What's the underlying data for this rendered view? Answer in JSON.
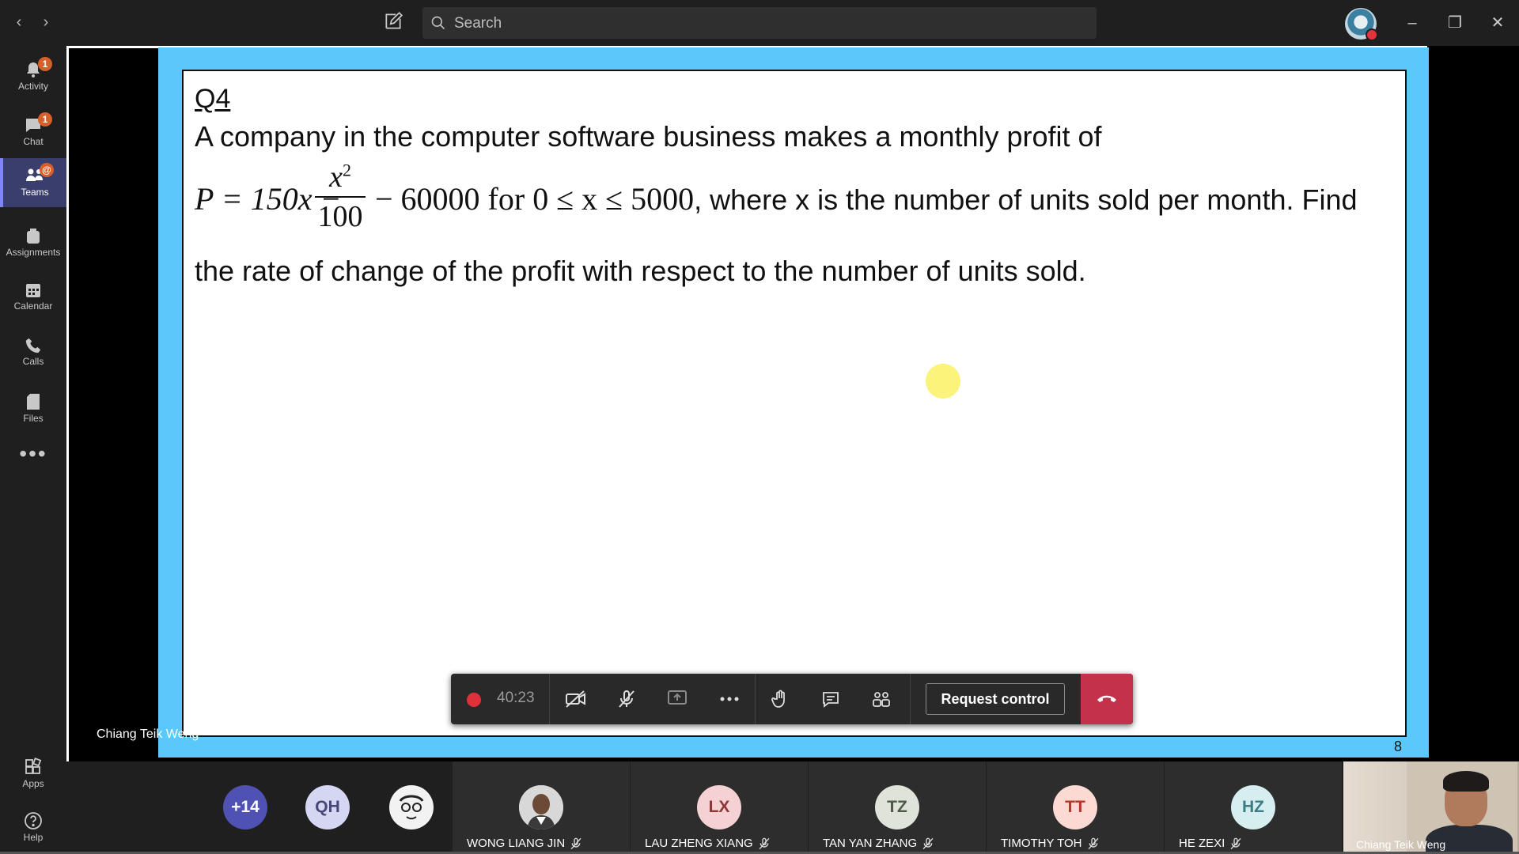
{
  "titlebar": {
    "search_placeholder": "Search"
  },
  "rail": {
    "items": [
      {
        "label": "Activity",
        "badge": "1"
      },
      {
        "label": "Chat",
        "badge": "1"
      },
      {
        "label": "Teams",
        "badge": "@"
      },
      {
        "label": "Assignments"
      },
      {
        "label": "Calendar"
      },
      {
        "label": "Calls"
      },
      {
        "label": "Files"
      }
    ],
    "more": "•••",
    "bottom": [
      {
        "label": "Apps"
      },
      {
        "label": "Help"
      }
    ]
  },
  "slide": {
    "question_title": "Q4",
    "line1": "A company in the computer software business makes a monthly profit of",
    "eq_lhs": "P = 150x −",
    "frac_num": "x",
    "frac_exp": "2",
    "frac_den": "100",
    "eq_rhs": "− 60000  for  0 ≤ x ≤ 5000",
    "line2_tail": ", where x is the number of units sold per month. Find",
    "line3": "the rate of change of the profit with respect to the number of units sold.",
    "page_number": "8",
    "presenter": "Chiang Teik Weng"
  },
  "controls": {
    "timer": "40:23",
    "request_control": "Request control"
  },
  "participants": {
    "overflow": "+14",
    "small": [
      "QH"
    ],
    "tiles": [
      {
        "name": "WONG LIANG JIN",
        "initials": ""
      },
      {
        "name": "LAU ZHENG XIANG",
        "initials": "LX"
      },
      {
        "name": "TAN YAN ZHANG",
        "initials": "TZ"
      },
      {
        "name": "TIMOTHY TOH",
        "initials": "TT"
      },
      {
        "name": "HE ZEXI",
        "initials": "HZ"
      }
    ],
    "self_name": "Chiang Teik Weng"
  }
}
